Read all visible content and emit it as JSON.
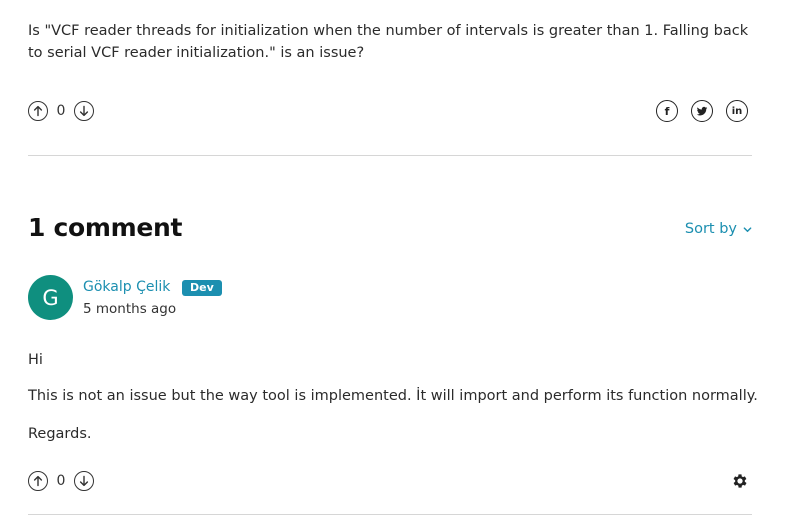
{
  "question": {
    "text": "Is \"VCF reader threads for initialization when the number of intervals is greater than 1. Falling back to serial VCF reader initialization.\" is an issue?",
    "votes": "0",
    "share_icons": [
      "facebook-icon",
      "twitter-icon",
      "linkedin-icon"
    ],
    "facebook_glyph": "f",
    "linkedin_glyph": "in"
  },
  "comments_section": {
    "heading": "1 comment",
    "sort_label": "Sort by"
  },
  "comment": {
    "avatar_initial": "G",
    "author": "Gökalp Çelik",
    "badge": "Dev",
    "time": "5 months ago",
    "paragraphs": [
      "Hi",
      "This is not an issue but the way tool is implemented. İt will import and perform its function normally.",
      "Regards."
    ],
    "votes": "0"
  },
  "colors": {
    "accent": "#1c8fb0",
    "avatar_bg": "#0f8f7f",
    "divider": "#d6d6d6"
  }
}
